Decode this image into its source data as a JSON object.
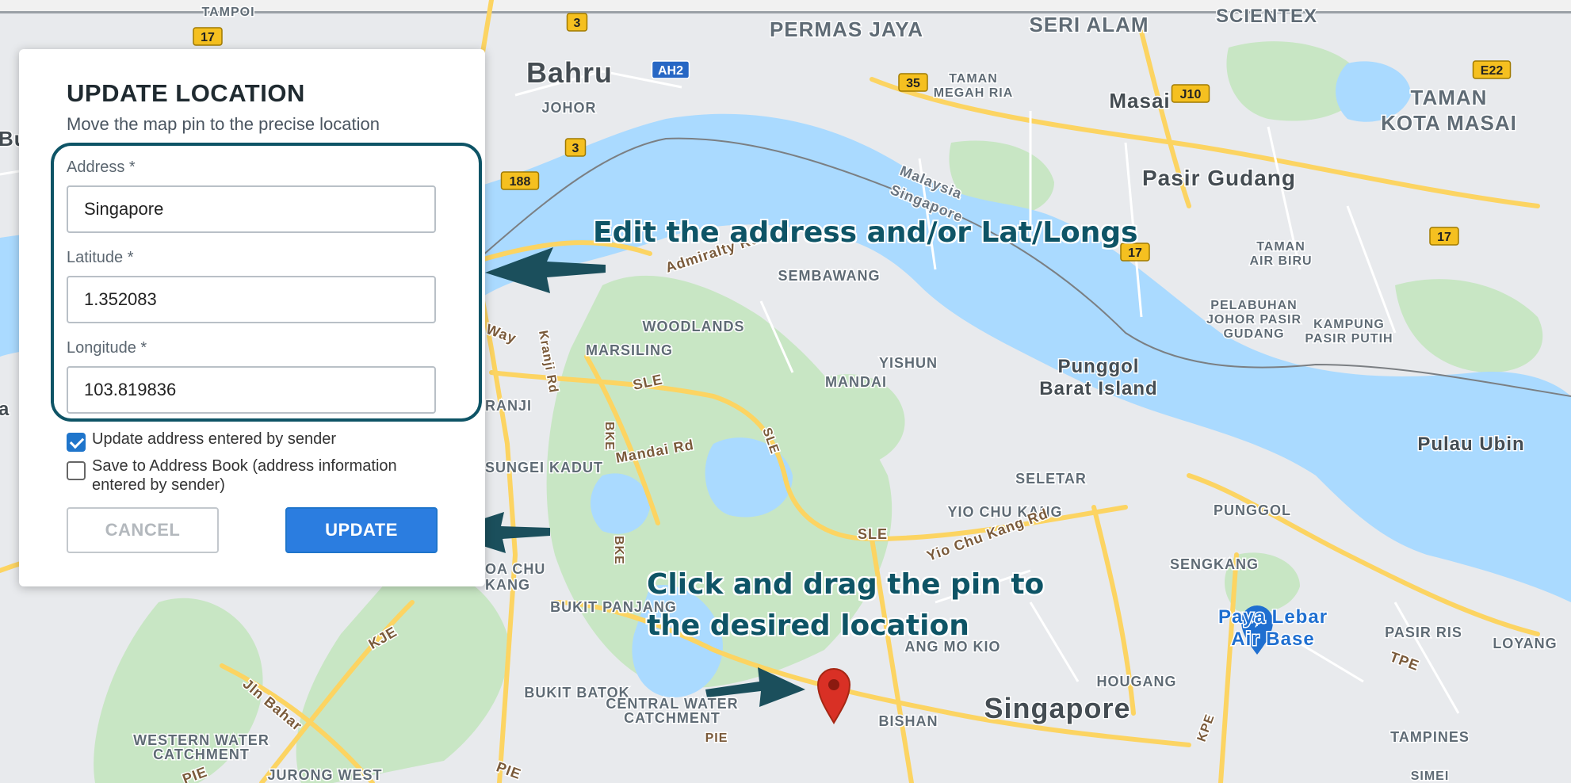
{
  "map": {
    "labels": [
      {
        "text": "TAMPOI",
        "size": 16,
        "color": "#5f6b75"
      },
      {
        "text": "Bahru",
        "size": 36,
        "color": "#444c52"
      },
      {
        "text": "JOHOR",
        "size": 18,
        "color": "#5f6b75"
      },
      {
        "text": "PERMAS JAYA",
        "size": 26,
        "color": "#5f6b75"
      },
      {
        "text": "SERI ALAM",
        "size": 26,
        "color": "#5f6b75"
      },
      {
        "text": "SCIENTEX",
        "size": 24,
        "color": "#5f6b75"
      },
      {
        "text": "TAMAN",
        "size": 16,
        "color": "#5f6b75"
      },
      {
        "text": "MEGAH RIA",
        "size": 16,
        "color": "#5f6b75"
      },
      {
        "text": "Masai",
        "size": 26,
        "color": "#444c52"
      },
      {
        "text": "TAMAN",
        "size": 26,
        "color": "#5f6b75"
      },
      {
        "text": "KOTA MASAI",
        "size": 26,
        "color": "#5f6b75"
      },
      {
        "text": "Pasir Gudang",
        "size": 28,
        "color": "#444c52"
      },
      {
        "text": "Malaysia",
        "size": 18,
        "color": "#6a7580"
      },
      {
        "text": "Singapore",
        "size": 18,
        "color": "#6a7580"
      },
      {
        "text": "TAMAN",
        "size": 16,
        "color": "#5f6b75"
      },
      {
        "text": "AIR BIRU",
        "size": 16,
        "color": "#5f6b75"
      },
      {
        "text": "Admiralty Rd",
        "size": 18,
        "color": "#7a5a3a"
      },
      {
        "text": "SEMBAWANG",
        "size": 18,
        "color": "#5f6b75"
      },
      {
        "text": "WOODLANDS",
        "size": 18,
        "color": "#5f6b75"
      },
      {
        "text": "MARSILING",
        "size": 18,
        "color": "#5f6b75"
      },
      {
        "text": "YISHUN",
        "size": 18,
        "color": "#5f6b75"
      },
      {
        "text": "MANDAI",
        "size": 18,
        "color": "#5f6b75"
      },
      {
        "text": "Punggol",
        "size": 24,
        "color": "#444c52"
      },
      {
        "text": "Barat Island",
        "size": 24,
        "color": "#444c52"
      },
      {
        "text": "PELABUHAN",
        "size": 16,
        "color": "#5f6b75"
      },
      {
        "text": "JOHOR PASIR",
        "size": 16,
        "color": "#5f6b75"
      },
      {
        "text": "GUDANG",
        "size": 16,
        "color": "#5f6b75"
      },
      {
        "text": "KAMPUNG",
        "size": 16,
        "color": "#5f6b75"
      },
      {
        "text": "PASIR PUTIH",
        "size": 16,
        "color": "#5f6b75"
      },
      {
        "text": "Pulau Ubin",
        "size": 24,
        "color": "#444c52"
      },
      {
        "text": "Way",
        "size": 18,
        "color": "#7a5a3a"
      },
      {
        "text": "Kranji Rd",
        "size": 16,
        "color": "#7a5a3a"
      },
      {
        "text": "RANJI",
        "size": 18,
        "color": "#5f6b75"
      },
      {
        "text": "SLE",
        "size": 18,
        "color": "#7a5a3a"
      },
      {
        "text": "BKE",
        "size": 16,
        "color": "#7a5a3a"
      },
      {
        "text": "SLE",
        "size": 16,
        "color": "#7a5a3a"
      },
      {
        "text": "Mandai Rd",
        "size": 18,
        "color": "#7a5a3a"
      },
      {
        "text": "SUNGEI KADUT",
        "size": 18,
        "color": "#5f6b75"
      },
      {
        "text": "SELETAR",
        "size": 18,
        "color": "#5f6b75"
      },
      {
        "text": "PUNGGOL",
        "size": 18,
        "color": "#5f6b75"
      },
      {
        "text": "YIO CHU KANG",
        "size": 18,
        "color": "#5f6b75"
      },
      {
        "text": "SLE",
        "size": 18,
        "color": "#7a5a3a"
      },
      {
        "text": "Yio Chu Kang Rd",
        "size": 18,
        "color": "#7a5a3a"
      },
      {
        "text": "SENGKANG",
        "size": 18,
        "color": "#5f6b75"
      },
      {
        "text": "BKE",
        "size": 16,
        "color": "#7a5a3a"
      },
      {
        "text": "OA CHU",
        "size": 18,
        "color": "#5f6b75"
      },
      {
        "text": "KANG",
        "size": 18,
        "color": "#5f6b75"
      },
      {
        "text": "BUKIT PANJANG",
        "size": 18,
        "color": "#5f6b75"
      },
      {
        "text": "Paya Lebar",
        "size": 24,
        "color": "#1f6fd0"
      },
      {
        "text": "Air Base",
        "size": 24,
        "color": "#1f6fd0"
      },
      {
        "text": "PASIR RIS",
        "size": 18,
        "color": "#5f6b75"
      },
      {
        "text": "LOYANG",
        "size": 18,
        "color": "#5f6b75"
      },
      {
        "text": "TPE",
        "size": 18,
        "color": "#7a5a3a"
      },
      {
        "text": "KJE",
        "size": 18,
        "color": "#7a5a3a"
      },
      {
        "text": "ANG MO KIO",
        "size": 18,
        "color": "#5f6b75"
      },
      {
        "text": "BUKIT BATOK",
        "size": 18,
        "color": "#5f6b75"
      },
      {
        "text": "CENTRAL WATER",
        "size": 18,
        "color": "#5f6b75"
      },
      {
        "text": "CATCHMENT",
        "size": 18,
        "color": "#5f6b75"
      },
      {
        "text": "HOUGANG",
        "size": 18,
        "color": "#5f6b75"
      },
      {
        "text": "Singapore",
        "size": 36,
        "color": "#444c52"
      },
      {
        "text": "BISHAN",
        "size": 18,
        "color": "#5f6b75"
      },
      {
        "text": "KPE",
        "size": 16,
        "color": "#7a5a3a"
      },
      {
        "text": "Jln Bahar",
        "size": 18,
        "color": "#7a5a3a"
      },
      {
        "text": "WESTERN WATER",
        "size": 18,
        "color": "#5f6b75"
      },
      {
        "text": "CATCHMENT",
        "size": 18,
        "color": "#5f6b75"
      },
      {
        "text": "PIE",
        "size": 18,
        "color": "#7a5a3a"
      },
      {
        "text": "PIE",
        "size": 18,
        "color": "#7a5a3a"
      },
      {
        "text": "JURONG WEST",
        "size": 18,
        "color": "#5f6b75"
      },
      {
        "text": "PIE",
        "size": 16,
        "color": "#7a5a3a"
      },
      {
        "text": "TAMPINES",
        "size": 18,
        "color": "#5f6b75"
      },
      {
        "text": "SIMEI",
        "size": 16,
        "color": "#5f6b75"
      },
      {
        "text": "Bu",
        "size": 26,
        "color": "#444c52"
      },
      {
        "text": "a",
        "size": 24,
        "color": "#444c52"
      }
    ],
    "shields": [
      {
        "text": "17",
        "type": "yellow"
      },
      {
        "text": "3",
        "type": "yellow"
      },
      {
        "text": "AH2",
        "type": "blue"
      },
      {
        "text": "3",
        "type": "yellow"
      },
      {
        "text": "188",
        "type": "yellow"
      },
      {
        "text": "35",
        "type": "yellow"
      },
      {
        "text": "J10",
        "type": "yellow"
      },
      {
        "text": "E22",
        "type": "yellow"
      },
      {
        "text": "17",
        "type": "yellow"
      },
      {
        "text": "17",
        "type": "yellow"
      }
    ]
  },
  "annotations": {
    "edit": "Edit the address and/or Lat/Longs",
    "drag_line1": "Click and drag the pin to",
    "drag_line2": "the desired location"
  },
  "panel": {
    "title": "UPDATE LOCATION",
    "subtitle": "Move the map pin to the precise location",
    "address_label": "Address *",
    "address_value": "Singapore",
    "latitude_label": "Latitude *",
    "latitude_value": "1.352083",
    "longitude_label": "Longitude *",
    "longitude_value": "103.819836",
    "update_address_label": "Update address entered by sender",
    "save_book_label": "Save to Address Book (address information entered by sender)",
    "cancel_label": "CANCEL",
    "update_label": "UPDATE"
  },
  "colors": {
    "water": "#aadaff",
    "land": "#e8eaed",
    "park": "#c8e6c4",
    "road": "#fcd462",
    "accent": "#0e5466",
    "pin": "#d93025",
    "primary": "#2b7de0"
  }
}
